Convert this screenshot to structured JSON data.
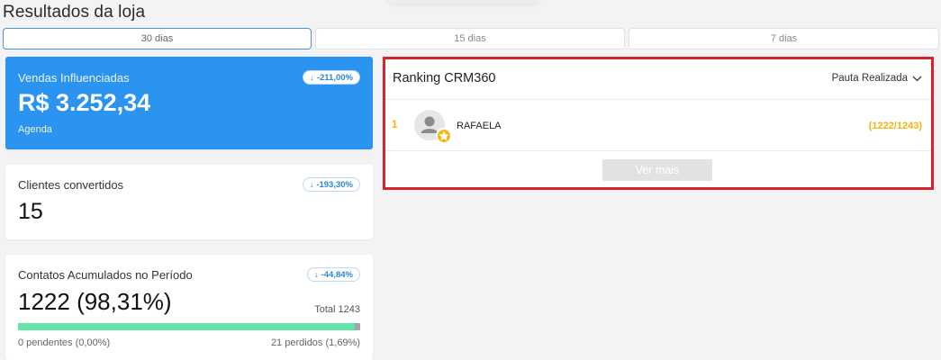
{
  "page_title": "Resultados da loja",
  "tabs": [
    {
      "label": "30 dias",
      "active": true
    },
    {
      "label": "15 dias",
      "active": false
    },
    {
      "label": "7 dias",
      "active": false
    }
  ],
  "cards": {
    "vendas": {
      "label": "Vendas Influenciadas",
      "badge": "-211,00%",
      "value": "R$ 3.252,34",
      "sub": "Agenda"
    },
    "clientes": {
      "label": "Clientes convertidos",
      "badge": "-193,30%",
      "value": "15"
    },
    "contatos": {
      "label": "Contatos Acumulados no Período",
      "badge": "-44,84%",
      "value": "1222 (98,31%)",
      "total": "Total 1243",
      "progress_percent": 98.31,
      "pending": "0 pendentes (0,00%)",
      "lost": "21 perdidos (1,69%)"
    }
  },
  "ranking": {
    "title": "Ranking CRM360",
    "filter": "Pauta Realizada",
    "rows": [
      {
        "position": "1",
        "name": "RAFAELA",
        "score": "(1222/1243)"
      }
    ],
    "more_label": "Ver mais"
  },
  "colors": {
    "accent_blue": "#2b94f0",
    "highlight_red": "#d9232a",
    "progress_green": "#62e4a7",
    "rank_gold": "#f3b20f"
  },
  "icons": {
    "badge_arrow": "arrow-down-icon",
    "filter_chevron": "chevron-down-icon",
    "avatar": "user-avatar-icon",
    "star": "star-icon"
  }
}
